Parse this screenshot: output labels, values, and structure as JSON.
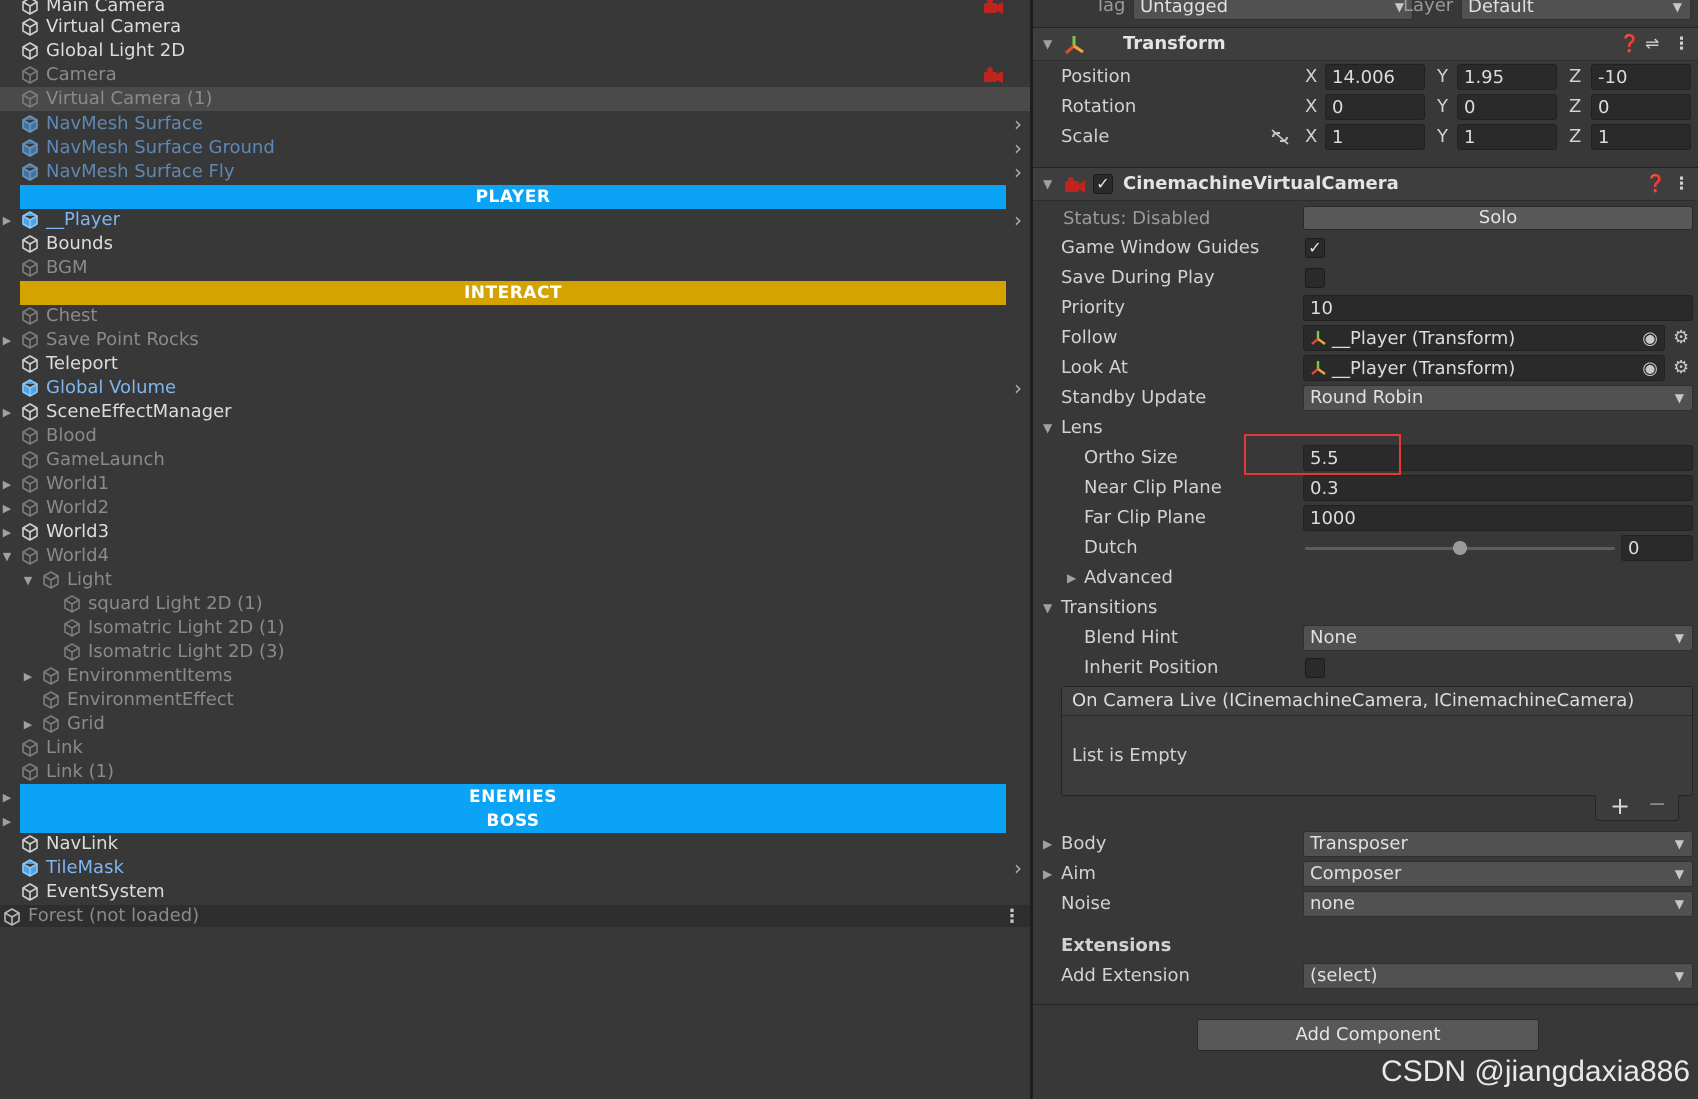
{
  "hierarchy": {
    "rows": [
      {
        "label": "Main Camera",
        "state": "active"
      },
      {
        "label": "Virtual Camera",
        "state": "active"
      },
      {
        "label": "Global Light 2D",
        "state": "active"
      },
      {
        "label": "Camera",
        "state": "inactive"
      },
      {
        "label": "Virtual Camera (1)",
        "state": "inactive"
      },
      {
        "label": "NavMesh Surface",
        "state": "prefab-inactive"
      },
      {
        "label": "NavMesh Surface Ground",
        "state": "prefab-inactive"
      },
      {
        "label": "NavMesh Surface Fly",
        "state": "prefab-inactive"
      },
      {
        "label": "PLAYER",
        "state": "header"
      },
      {
        "label": "__Player",
        "state": "prefab"
      },
      {
        "label": "Bounds",
        "state": "active"
      },
      {
        "label": "BGM",
        "state": "inactive"
      },
      {
        "label": "INTERACT",
        "state": "header"
      },
      {
        "label": "Chest",
        "state": "inactive"
      },
      {
        "label": "Save Point Rocks",
        "state": "inactive"
      },
      {
        "label": "Teleport",
        "state": "active"
      },
      {
        "label": "Global Volume",
        "state": "prefab"
      },
      {
        "label": "SceneEffectManager",
        "state": "active"
      },
      {
        "label": "Blood",
        "state": "inactive"
      },
      {
        "label": "GameLaunch",
        "state": "inactive"
      },
      {
        "label": "World1",
        "state": "inactive"
      },
      {
        "label": "World2",
        "state": "inactive"
      },
      {
        "label": "World3",
        "state": "active"
      },
      {
        "label": "World4",
        "state": "inactive"
      },
      {
        "label": "Light",
        "state": "inactive"
      },
      {
        "label": "squard Light 2D (1)",
        "state": "inactive"
      },
      {
        "label": "Isomatric Light 2D (1)",
        "state": "inactive"
      },
      {
        "label": "Isomatric Light 2D (3)",
        "state": "inactive"
      },
      {
        "label": "EnvironmentItems",
        "state": "inactive"
      },
      {
        "label": "EnvironmentEffect",
        "state": "inactive"
      },
      {
        "label": "Grid",
        "state": "inactive"
      },
      {
        "label": "Link",
        "state": "inactive"
      },
      {
        "label": "Link (1)",
        "state": "inactive"
      },
      {
        "label": "ENEMIES",
        "state": "header"
      },
      {
        "label": "BOSS",
        "state": "header"
      },
      {
        "label": "NavLink",
        "state": "active"
      },
      {
        "label": "TileMask",
        "state": "prefab"
      },
      {
        "label": "EventSystem",
        "state": "active"
      },
      {
        "label": "Forest (not loaded)",
        "state": "scene"
      }
    ],
    "header_colors": {
      "player": "#0aa3f5",
      "interact": "#d4a300",
      "enemies": "#0aa3f5"
    }
  },
  "inspector": {
    "top": {
      "tag_label": "Tag",
      "tag_value": "Untagged",
      "layer_label": "Layer",
      "layer_value": "Default"
    },
    "transform": {
      "title": "Transform",
      "position_label": "Position",
      "rotation_label": "Rotation",
      "scale_label": "Scale",
      "axis_x": "X",
      "axis_y": "Y",
      "axis_z": "Z",
      "position": [
        "14.006",
        "1.95",
        "-10"
      ],
      "rotation": [
        "0",
        "0",
        "0"
      ],
      "scale": [
        "1",
        "1",
        "1"
      ]
    },
    "vcam": {
      "title": "CinemachineVirtualCamera",
      "status_label": "Status: Disabled",
      "solo_label": "Solo",
      "game_window_guides_label": "Game Window Guides",
      "game_window_guides": true,
      "save_during_play_label": "Save During Play",
      "save_during_play": false,
      "priority_label": "Priority",
      "priority": "10",
      "follow_label": "Follow",
      "follow": "__Player (Transform)",
      "look_at_label": "Look At",
      "look_at": "__Player (Transform)",
      "standby_label": "Standby Update",
      "standby": "Round Robin",
      "lens_label": "Lens",
      "ortho_label": "Ortho Size",
      "ortho": "5.5",
      "near_label": "Near Clip Plane",
      "near": "0.3",
      "far_label": "Far Clip Plane",
      "far": "1000",
      "dutch_label": "Dutch",
      "dutch": "0",
      "dutch_slider_fraction": 0.5,
      "advanced_label": "Advanced",
      "transitions_label": "Transitions",
      "blend_hint_label": "Blend Hint",
      "blend_hint": "None",
      "inherit_label": "Inherit Position",
      "inherit": false,
      "event_title": "On Camera Live (ICinemachineCamera, ICinemachineCamera)",
      "event_empty": "List is Empty",
      "plus": "+",
      "minus": "−",
      "body_label": "Body",
      "body": "Transposer",
      "aim_label": "Aim",
      "aim": "Composer",
      "noise_label": "Noise",
      "noise": "none",
      "extensions_label": "Extensions",
      "add_extension_label": "Add Extension",
      "add_extension": "(select)"
    },
    "add_component_label": "Add Component"
  },
  "watermark": "CSDN @jiangdaxia886"
}
